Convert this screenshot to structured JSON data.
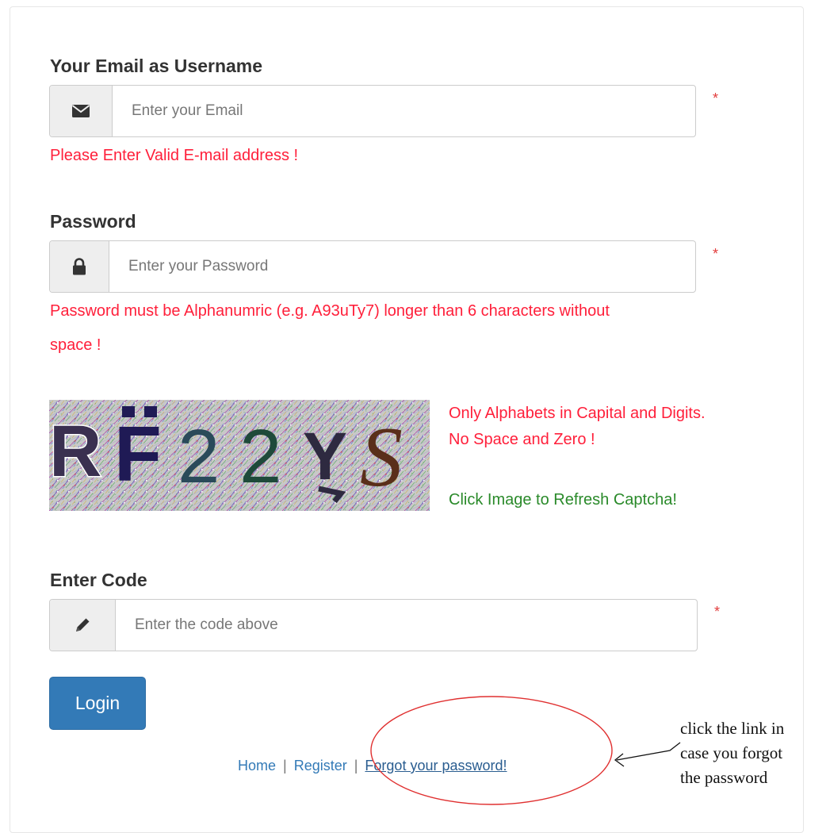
{
  "email": {
    "label": "Your Email as Username",
    "icon": "envelope-icon",
    "placeholder": "Enter your Email",
    "value": "",
    "required_mark": "*",
    "error": "Please Enter Valid E-mail address !"
  },
  "password": {
    "label": "Password",
    "icon": "lock-icon",
    "placeholder": "Enter your Password",
    "value": "",
    "required_mark": "*",
    "error_line1": "Password must be Alphanumric (e.g. A93uTy7) longer than 6 characters without",
    "error_line2": "space !"
  },
  "captcha": {
    "characters": [
      "R",
      "F",
      "2",
      "2",
      "Y",
      "S"
    ],
    "hint_line1": "Only Alphabets in Capital and Digits.",
    "hint_line2": "No Space and Zero !",
    "refresh_hint": "Click Image to Refresh Captcha!"
  },
  "code": {
    "label": "Enter Code",
    "icon": "pencil-icon",
    "placeholder": "Enter the code above",
    "value": "",
    "required_mark": "*"
  },
  "login": {
    "label": "Login"
  },
  "footer": {
    "home": "Home",
    "register": "Register",
    "forgot": "Forgot your password!",
    "separator": "|"
  },
  "annotation": {
    "line1": "click the link in",
    "line2": "case you forgot",
    "line3": "the password"
  },
  "colors": {
    "accent": "#337ab7",
    "error": "#ff1f3a",
    "success": "#2a8a2a",
    "required": "#e23b3b",
    "annotation_circle": "#e03030"
  }
}
